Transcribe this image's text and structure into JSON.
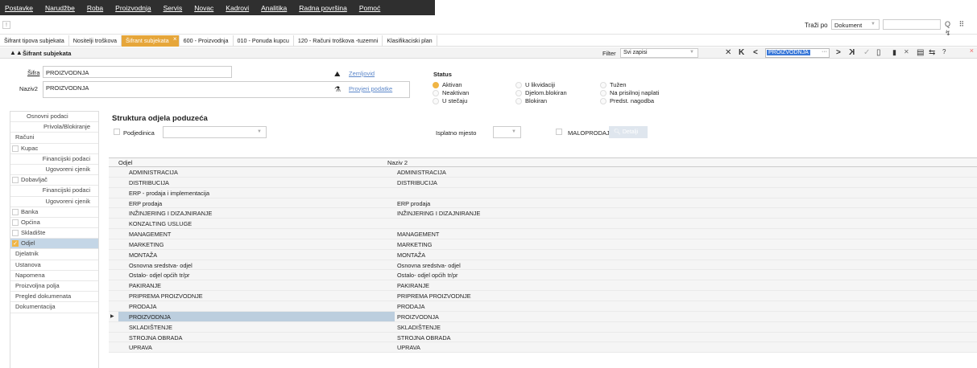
{
  "menu": [
    "Postavke",
    "Narudžbe",
    "Roba",
    "Proizvodnja",
    "Servis",
    "Novac",
    "Kadrovi",
    "Analitika",
    "Radna površina",
    "Pomoć"
  ],
  "topbar": {
    "excl": "!",
    "search_label": "Traži po",
    "search_select": "Dokument",
    "icons": "Q ⠿ ↯"
  },
  "tabs": [
    "Šifrant tipova subjekata",
    "Nositelji troškova",
    "Šifrant subjekata",
    "600 - Proizvodnja",
    "010 - Ponuda kupcu",
    "120 - Računi troškova -tuzemni",
    "Klasifikaciski plan"
  ],
  "active_tab": "Šifrant subjekata",
  "form": {
    "title": "Šifrant subjekata",
    "filter_label": "Filter",
    "filter_value": "Svi zapisi",
    "nav_value": "PROIZVODNJA",
    "nav_dots": "···",
    "close": "×",
    "nav_icons": [
      "✕",
      "K",
      "<",
      ">",
      "K",
      "✓",
      "▯",
      "▮",
      "✕",
      "▤",
      "⇆",
      "?"
    ]
  },
  "fields": {
    "sifra_label": "Šifra",
    "sifra_value": "PROIZVODNJA",
    "naziv_label": "Naziv2",
    "naziv_value": "PROIZVODNJA",
    "zemljovid": "Zemljovid",
    "provjeri": "Provjeri podatke"
  },
  "status": {
    "label": "Status",
    "options": [
      {
        "label": "Aktivan",
        "on": true
      },
      {
        "label": "U likvidaciji",
        "on": false
      },
      {
        "label": "Tužen",
        "on": false
      },
      {
        "label": "Neaktivan",
        "on": false
      },
      {
        "label": "Djelom.blokiran",
        "on": false
      },
      {
        "label": "Na prisilnoj naplati",
        "on": false
      },
      {
        "label": "U stečaju",
        "on": false
      },
      {
        "label": "Blokiran",
        "on": false
      },
      {
        "label": "Predst. nagodba",
        "on": false
      }
    ]
  },
  "sidebar": [
    {
      "label": "Osnovni podaci",
      "type": "center"
    },
    {
      "label": "Privola/Blokiranje",
      "type": "sub"
    },
    {
      "label": "Računi",
      "type": "top"
    },
    {
      "label": "Kupac",
      "type": "cb"
    },
    {
      "label": "Financijski podaci",
      "type": "sub"
    },
    {
      "label": "Ugovoreni cjenik",
      "type": "sub"
    },
    {
      "label": "Dobavljač",
      "type": "cb"
    },
    {
      "label": "Financijski podaci",
      "type": "sub"
    },
    {
      "label": "Ugovoreni cjenik",
      "type": "sub"
    },
    {
      "label": "Banka",
      "type": "cb"
    },
    {
      "label": "Općina",
      "type": "cb"
    },
    {
      "label": "Skladište",
      "type": "cb"
    },
    {
      "label": "Odjel",
      "type": "cb",
      "checked": true,
      "selected": true
    },
    {
      "label": "Djelatnik",
      "type": "top"
    },
    {
      "label": "Ustanova",
      "type": "top"
    },
    {
      "label": "Napomena",
      "type": "top"
    },
    {
      "label": "Proizvoljna polja",
      "type": "top"
    },
    {
      "label": "Pregled dokumenata",
      "type": "top"
    },
    {
      "label": "Dokumentacija",
      "type": "top"
    }
  ],
  "section": {
    "title": "Struktura odjela poduzeća",
    "podjedinica": "Podjedinica",
    "isplatno": "Isplatno mjesto",
    "maloprodaja": "MALOPRODAJA",
    "detalji": "Detalji"
  },
  "grid": {
    "headers": [
      "Odjel",
      "Naziv 2"
    ],
    "rows": [
      [
        "ADMINISTRACIJA",
        "ADMINISTRACIJA"
      ],
      [
        "DISTRIBUCIJA",
        "DISTRIBUCIJA"
      ],
      [
        "ERP - prodaja i implementacija",
        ""
      ],
      [
        "ERP prodaja",
        "ERP prodaja"
      ],
      [
        "INŽINJERING I DIZAJNIRANJE",
        "INŽINJERING I DIZAJNIRANJE"
      ],
      [
        "KONZALTING USLUGE",
        ""
      ],
      [
        "MANAGEMENT",
        "MANAGEMENT"
      ],
      [
        "MARKETING",
        "MARKETING"
      ],
      [
        "MONTAŽA",
        "MONTAŽA"
      ],
      [
        "Osnovna sredstva- odjel",
        "Osnovna sredstva- odjel"
      ],
      [
        "Ostalo- odjel općih tr/pr",
        "Ostalo- odjel općih tr/pr"
      ],
      [
        "PAKIRANJE",
        "PAKIRANJE"
      ],
      [
        "PRIPREMA PROIZVODNJE",
        "PRIPREMA PROIZVODNJE"
      ],
      [
        "PRODAJA",
        "PRODAJA"
      ],
      [
        "PROIZVODNJA",
        "PROIZVODNJA"
      ],
      [
        "SKLADIŠTENJE",
        "SKLADIŠTENJE"
      ],
      [
        "STROJNA OBRADA",
        "STROJNA OBRADA"
      ],
      [
        "UPRAVA",
        "UPRAVA"
      ]
    ],
    "selected_index": 14
  }
}
